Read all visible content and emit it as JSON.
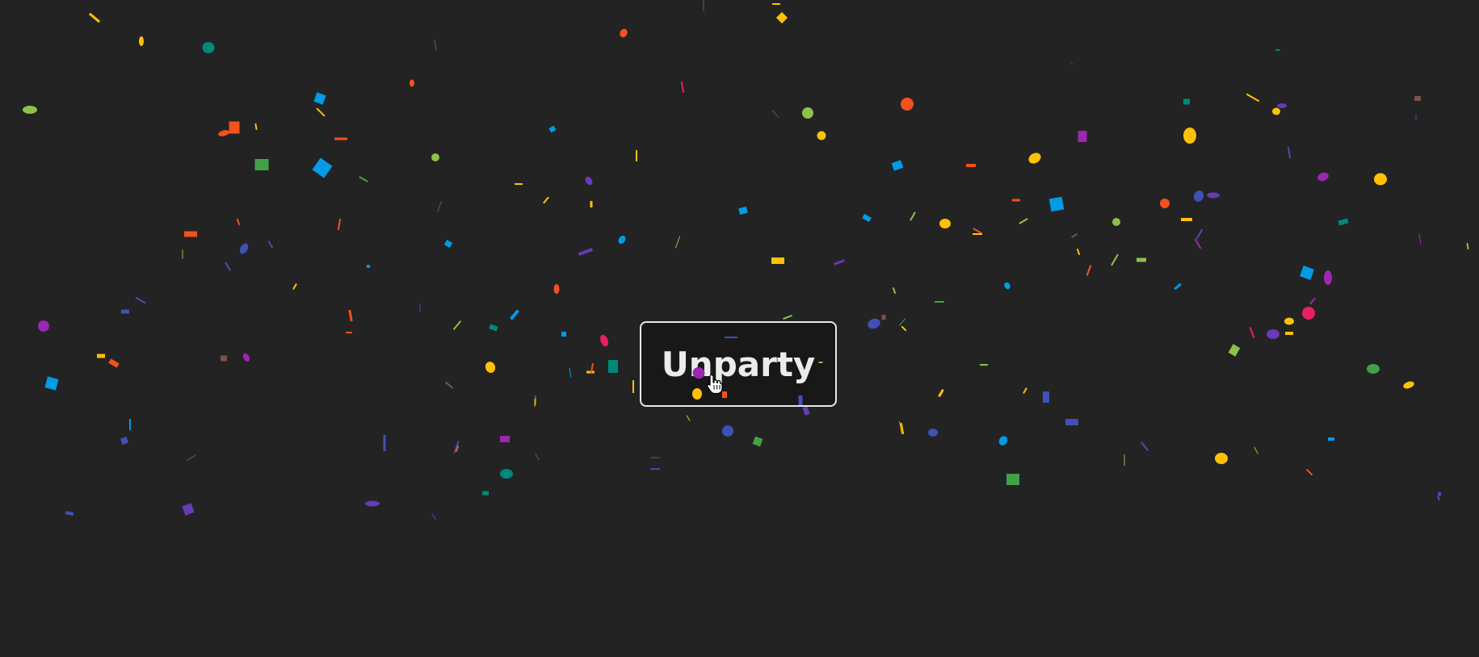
{
  "page": {
    "background": "#232323"
  },
  "button": {
    "label": "Unparty",
    "border_color": "#e8e8e8",
    "text_color": "#ececec"
  },
  "cursor": {
    "icon": "hand-pointer-icon"
  },
  "confetti": {
    "palette": [
      "#f4511e",
      "#ffc107",
      "#3f51b5",
      "#9c27b0",
      "#00897b",
      "#43a047",
      "#039be5",
      "#cddc39",
      "#e91e63",
      "#ff9800",
      "#673ab7",
      "#795548",
      "#ffeb3b",
      "#8bc34a",
      "#2196f3"
    ]
  }
}
